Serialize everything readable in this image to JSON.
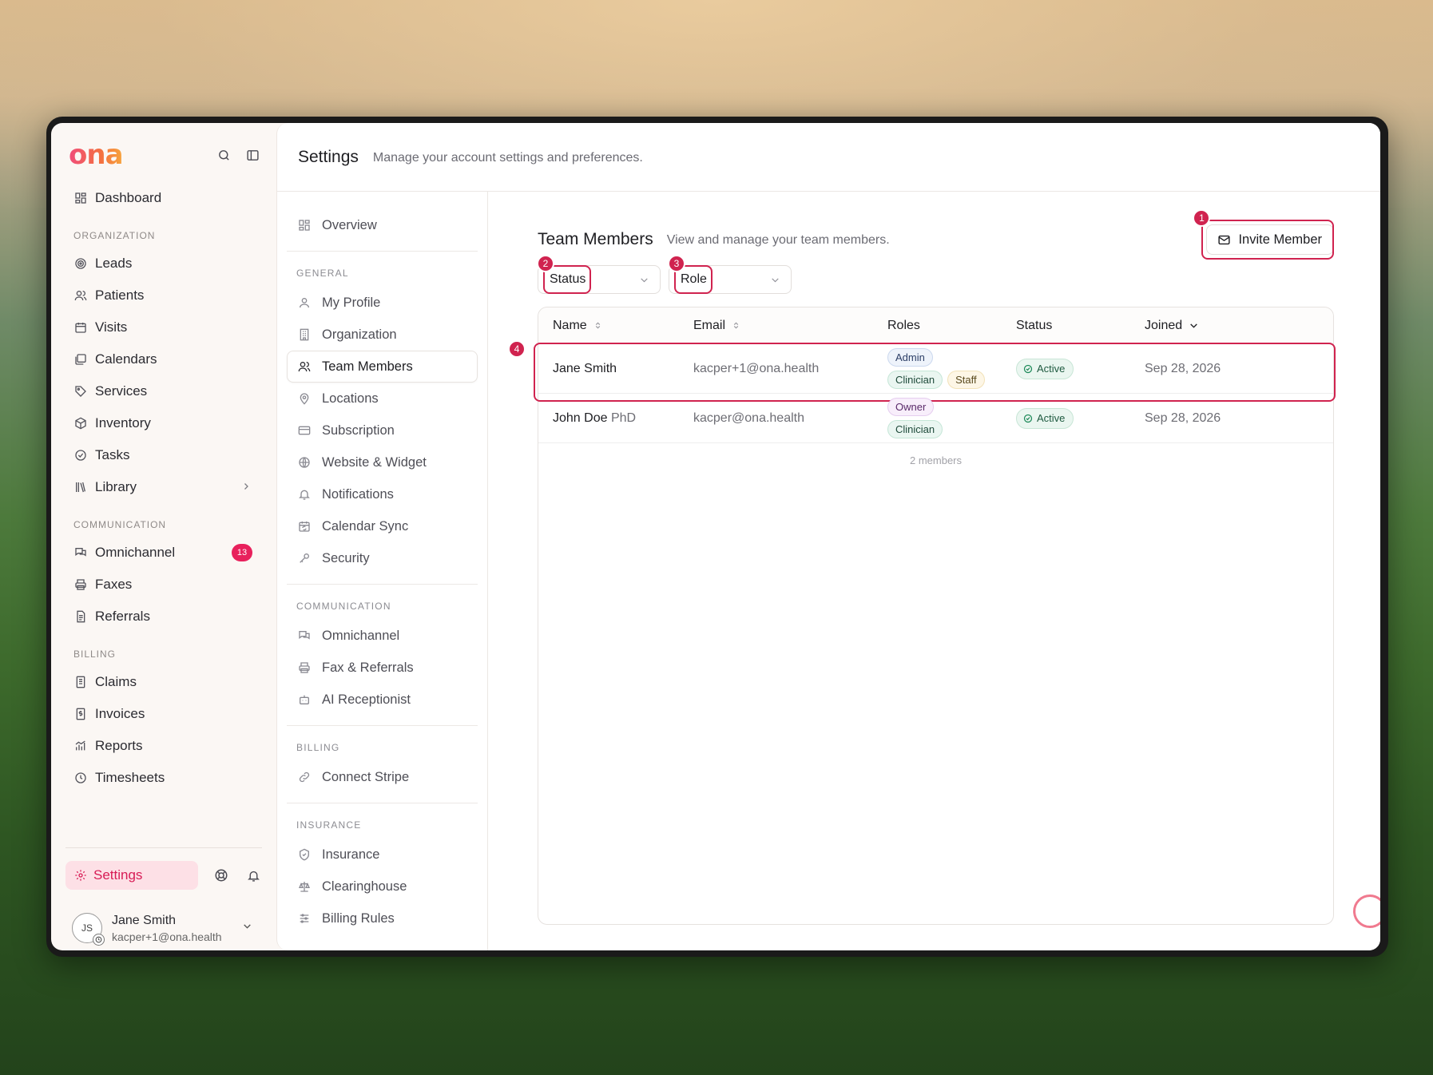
{
  "app": {
    "logo": "ona"
  },
  "sidebar": {
    "top_items": [
      {
        "label": "Dashboard",
        "icon": "dashboard-icon"
      }
    ],
    "sections": [
      {
        "title": "ORGANIZATION",
        "items": [
          {
            "label": "Leads",
            "icon": "target-icon"
          },
          {
            "label": "Patients",
            "icon": "users-icon"
          },
          {
            "label": "Visits",
            "icon": "calendar-icon"
          },
          {
            "label": "Calendars",
            "icon": "calendars-icon"
          },
          {
            "label": "Services",
            "icon": "tag-icon"
          },
          {
            "label": "Inventory",
            "icon": "box-icon"
          },
          {
            "label": "Tasks",
            "icon": "check-circle-icon"
          },
          {
            "label": "Library",
            "icon": "library-icon"
          }
        ]
      },
      {
        "title": "COMMUNICATION",
        "items": [
          {
            "label": "Omnichannel",
            "icon": "chat-icon",
            "badge": "13"
          },
          {
            "label": "Faxes",
            "icon": "printer-icon"
          },
          {
            "label": "Referrals",
            "icon": "document-icon"
          }
        ]
      },
      {
        "title": "BILLING",
        "items": [
          {
            "label": "Claims",
            "icon": "claims-icon"
          },
          {
            "label": "Invoices",
            "icon": "invoice-icon"
          },
          {
            "label": "Reports",
            "icon": "chart-icon"
          },
          {
            "label": "Timesheets",
            "icon": "clock-icon"
          }
        ]
      }
    ],
    "settings_label": "Settings",
    "user": {
      "initials": "JS",
      "name": "Jane Smith",
      "email": "kacper+1@ona.health"
    }
  },
  "header": {
    "title": "Settings",
    "subtitle": "Manage your account settings and preferences."
  },
  "subnav": {
    "overview": "Overview",
    "sections": [
      {
        "title": "GENERAL",
        "items": [
          "My Profile",
          "Organization",
          "Team Members",
          "Locations",
          "Subscription",
          "Website & Widget",
          "Notifications",
          "Calendar Sync",
          "Security"
        ]
      },
      {
        "title": "COMMUNICATION",
        "items": [
          "Omnichannel",
          "Fax & Referrals",
          "AI Receptionist"
        ]
      },
      {
        "title": "BILLING",
        "items": [
          "Connect Stripe"
        ]
      },
      {
        "title": "INSURANCE",
        "items": [
          "Insurance",
          "Clearinghouse",
          "Billing Rules"
        ]
      }
    ],
    "active": "Team Members"
  },
  "team": {
    "title": "Team Members",
    "subtitle": "View and manage your team members.",
    "invite_label": "Invite Member",
    "filters": {
      "status": "Status",
      "role": "Role"
    },
    "columns": {
      "name": "Name",
      "email": "Email",
      "roles": "Roles",
      "status": "Status",
      "joined": "Joined"
    },
    "rows": [
      {
        "name": "Jane Smith",
        "suffix": "",
        "email": "kacper+1@ona.health",
        "roles": [
          "Admin",
          "Clinician",
          "Staff"
        ],
        "status": "Active",
        "joined": "Sep 28, 2026"
      },
      {
        "name": "John Doe",
        "suffix": "PhD",
        "email": "kacper@ona.health",
        "roles": [
          "Owner",
          "Clinician"
        ],
        "status": "Active",
        "joined": "Sep 28, 2026"
      }
    ],
    "count_label": "2 members"
  },
  "annotations": [
    "1",
    "2",
    "3",
    "4"
  ],
  "colors": {
    "accent": "#d0234f",
    "badge": "#e8215c",
    "settings_bg": "#fde0e6"
  }
}
